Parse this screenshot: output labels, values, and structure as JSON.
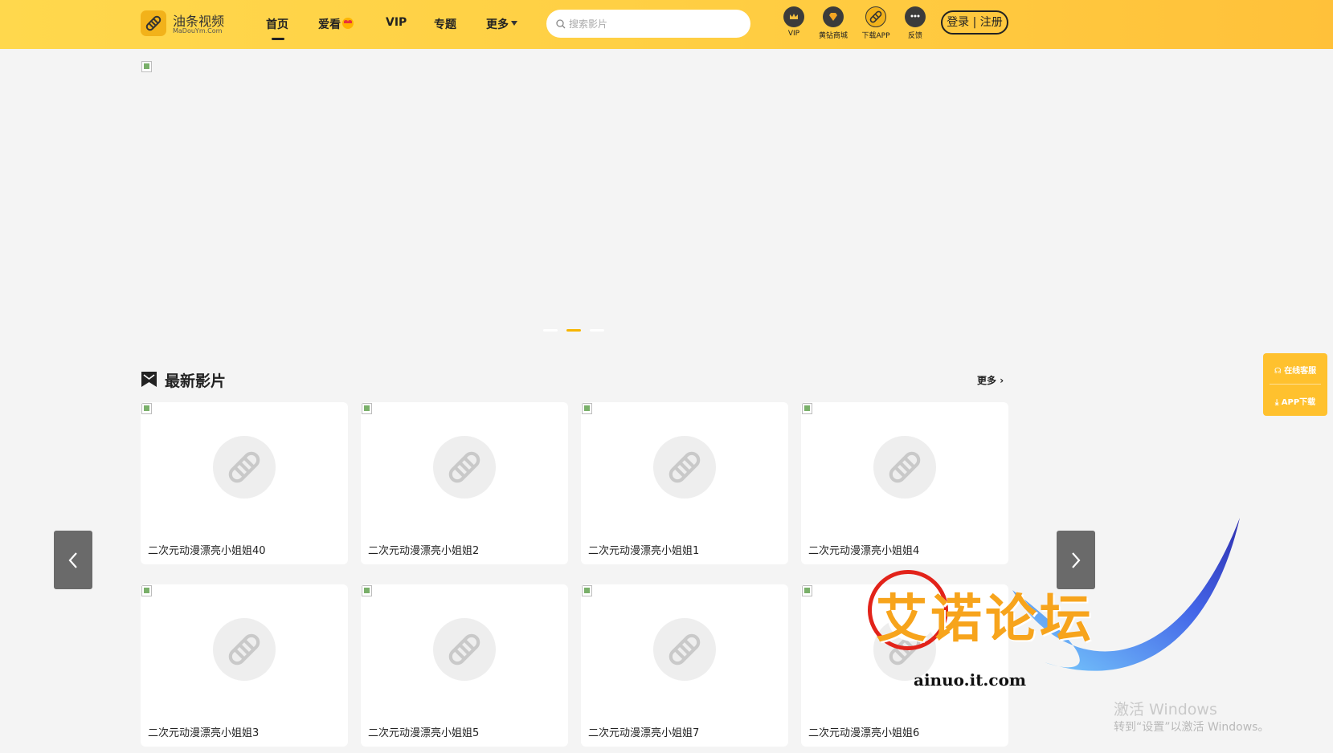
{
  "header": {
    "logo_title": "油条视频",
    "logo_sub": "MaDouYm.Com",
    "nav": [
      "首页",
      "爱看",
      "VIP",
      "专题",
      "更多"
    ],
    "search_placeholder": "搜索影片",
    "icons": [
      {
        "name": "vip-crown-icon",
        "label": "VIP"
      },
      {
        "name": "diamond-shop-icon",
        "label": "黄钻商城"
      },
      {
        "name": "download-app-icon",
        "label": "下载APP"
      },
      {
        "name": "feedback-icon",
        "label": "反馈"
      }
    ],
    "login_label": "登录 | 注册"
  },
  "banner": {
    "dot_count": 3,
    "active_dot": 1
  },
  "section": {
    "title": "最新影片",
    "more_label": "更多",
    "cards": [
      "二次元动漫漂亮小姐姐40",
      "二次元动漫漂亮小姐姐2",
      "二次元动漫漂亮小姐姐1",
      "二次元动漫漂亮小姐姐4",
      "二次元动漫漂亮小姐姐3",
      "二次元动漫漂亮小姐姐5",
      "二次元动漫漂亮小姐姐7",
      "二次元动漫漂亮小姐姐6"
    ]
  },
  "side_tools": {
    "service": "在线客服",
    "app": "APP下载"
  },
  "watermark": {
    "brand": "艾诺论坛",
    "url": "ainuo.it.com"
  },
  "windows_notice": {
    "line1": "激活 Windows",
    "line2": "转到“设置”以激活 Windows。"
  },
  "colors": {
    "accent": "#ffcf43",
    "active_dot": "#f7b500",
    "side_tools": "#ffc12e"
  }
}
